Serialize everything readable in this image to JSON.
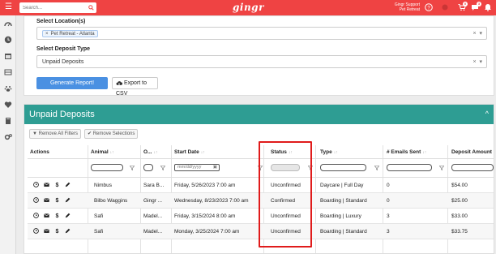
{
  "topbar": {
    "search_placeholder": "Search...",
    "logo": "gingr",
    "user_line1": "Gingr Support",
    "user_line2": "Pet Retreat",
    "cart_badge": "0",
    "chat_badge": "3"
  },
  "filters": {
    "location_label": "Select Location(s)",
    "location_chip": "Pet Retreat - Atlanta",
    "deposit_type_label": "Select Deposit Type",
    "deposit_type_value": "Unpaid Deposits",
    "generate_button": "Generate Report!",
    "export_button": "Export to CSV"
  },
  "panel": {
    "title": "Unpaid Deposits",
    "remove_filters": "Remove All Filters",
    "remove_selections": "Remove Selections"
  },
  "table": {
    "columns": {
      "actions": "Actions",
      "animal": "Animal",
      "owner": "O...",
      "start_date": "Start Date",
      "status": "Status",
      "type": "Type",
      "emails_sent": "# Emails Sent",
      "deposit_amount": "Deposit Amount"
    },
    "date_placeholder": "mm/dd/yyyy",
    "rows": [
      {
        "animal": "Nimbus",
        "owner": "Sara B...",
        "start_date": "Friday, 5/26/2023 7:00 am",
        "status": "Unconfirmed",
        "type": "Daycare | Full Day",
        "emails_sent": "0",
        "deposit": "$54.00"
      },
      {
        "animal": "Bilbo Waggins",
        "owner": "Gingr ...",
        "start_date": "Wednesday, 8/23/2023 7:00 am",
        "status": "Confirmed",
        "type": "Boarding | Standard",
        "emails_sent": "0",
        "deposit": "$25.00"
      },
      {
        "animal": "Safi",
        "owner": "Madel...",
        "start_date": "Friday, 3/15/2024 8:00 am",
        "status": "Unconfirmed",
        "type": "Boarding | Luxury",
        "emails_sent": "3",
        "deposit": "$33.00"
      },
      {
        "animal": "Safi",
        "owner": "Madel...",
        "start_date": "Monday, 3/25/2024 7:00 am",
        "status": "Unconfirmed",
        "type": "Boarding | Standard",
        "emails_sent": "3",
        "deposit": "$33.75"
      }
    ]
  },
  "colors": {
    "brand_red": "#ef4343",
    "panel_teal": "#2e9d93",
    "primary_blue": "#4a90e2",
    "highlight_red": "#e01b1b"
  },
  "icons": {
    "sidebar": [
      "dashboard-icon",
      "clock-icon",
      "calendar-icon",
      "grid-icon",
      "paw-icon",
      "heart-icon",
      "book-icon",
      "gears-icon"
    ],
    "row_actions": [
      "clock-icon",
      "envelope-icon",
      "dollar-icon",
      "pencil-icon"
    ]
  }
}
